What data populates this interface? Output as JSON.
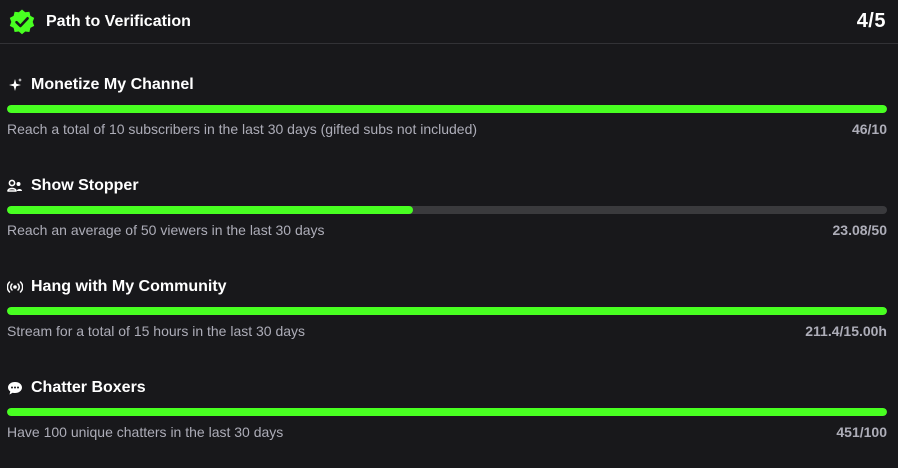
{
  "header": {
    "title": "Path to Verification",
    "count": "4/5",
    "badge_color": "#48ff21"
  },
  "goals": [
    {
      "icon": "sparkle-icon",
      "title": "Monetize My Channel",
      "description": "Reach a total of 10 subscribers in the last 30 days (gifted subs not included)",
      "value": "46/10",
      "progress": 1.0
    },
    {
      "icon": "users-icon",
      "title": "Show Stopper",
      "description": "Reach an average of 50 viewers in the last 30 days",
      "value": "23.08/50",
      "progress": 0.4616
    },
    {
      "icon": "broadcast-icon",
      "title": "Hang with My Community",
      "description": "Stream for a total of 15 hours in the last 30 days",
      "value": "211.4/15.00h",
      "progress": 1.0
    },
    {
      "icon": "chat-bubble-icon",
      "title": "Chatter Boxers",
      "description": "Have 100 unique chatters in the last 30 days",
      "value": "451/100",
      "progress": 1.0
    }
  ],
  "colors": {
    "progress_fill": "#48ff21",
    "progress_track": "#3a3a3d",
    "background": "#18181b"
  }
}
